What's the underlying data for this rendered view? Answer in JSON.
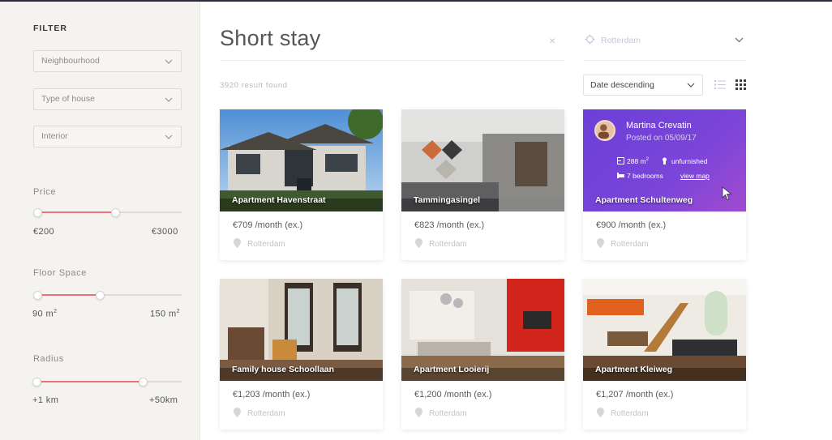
{
  "sidebar": {
    "title": "FILTER",
    "selects": [
      {
        "label": "Neighbourhood"
      },
      {
        "label": "Type of house"
      },
      {
        "label": "Interior"
      }
    ],
    "price": {
      "label": "Price",
      "min": "€200",
      "max": "€3000",
      "range_fraction": [
        0.0,
        0.54
      ]
    },
    "floor": {
      "label": "Floor Space",
      "min": "90 m",
      "max": "150 m",
      "sup": "2",
      "range_fraction": [
        0.0,
        0.43
      ]
    },
    "radius": {
      "label": "Radius",
      "min": "+1 km",
      "max": "+50km",
      "range_fraction": [
        0.0,
        0.73
      ]
    }
  },
  "search": {
    "query": "Short stay",
    "clear": "×"
  },
  "location": {
    "value": "Rotterdam"
  },
  "results": {
    "count_text": "3920 result found"
  },
  "sort": {
    "value": "Date descending"
  },
  "cards": [
    {
      "title": "Apartment Havenstraat",
      "price": "€709 /month (ex.)",
      "city": "Rotterdam"
    },
    {
      "title": "Tammingasingel",
      "price": "€823 /month (ex.)",
      "city": "Rotterdam"
    },
    {
      "title": "Apartment Schultenweg",
      "price": "€900 /month (ex.)",
      "city": "Rotterdam",
      "agent": {
        "name": "Martina Crevatin",
        "posted": "Posted on 05/09/17",
        "area": "288 m",
        "area_sup": "2",
        "furnish": "unfurnished",
        "bedrooms": "7 bedrooms",
        "map_link": "view map"
      }
    },
    {
      "title": "Family house Schoollaan",
      "price": "€1,203 /month (ex.)",
      "city": "Rotterdam"
    },
    {
      "title": "Apartment Looierij",
      "price": "€1,200 /month (ex.)",
      "city": "Rotterdam"
    },
    {
      "title": "Apartment Kleiweg",
      "price": "€1,207 /month (ex.)",
      "city": "Rotterdam"
    }
  ],
  "colors": {
    "accent": "#ef6f7a",
    "purple": "#6b3fd8",
    "sidebar_bg": "#f4f3f0"
  }
}
